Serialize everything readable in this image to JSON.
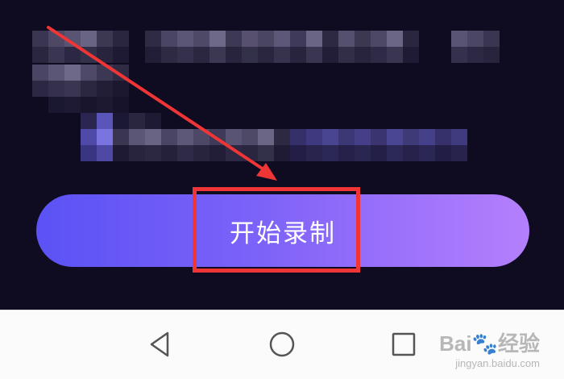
{
  "record": {
    "start_label": "开始录制"
  },
  "navigation": {
    "back_icon": "triangle-back-icon",
    "home_icon": "circle-home-icon",
    "recents_icon": "square-recents-icon"
  },
  "watermark": {
    "brand": "Bai",
    "brand_suffix": "经验",
    "url": "jingyan.baidu.com"
  },
  "colors": {
    "background": "#0f0c22",
    "button_gradient_start": "#5b52f5",
    "button_gradient_end": "#b480fc",
    "highlight": "#ef3535",
    "nav_bar": "#fbfbfb"
  }
}
